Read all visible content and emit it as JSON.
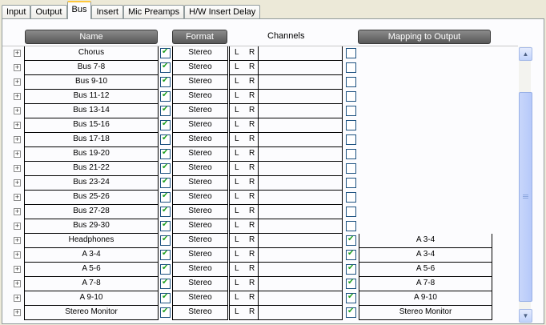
{
  "tabs": [
    "Input",
    "Output",
    "Bus",
    "Insert",
    "Mic Preamps",
    "H/W Insert Delay"
  ],
  "active_tab": "Bus",
  "headers": {
    "name": "Name",
    "format": "Format",
    "channels": "Channels",
    "mapping": "Mapping to Output"
  },
  "rows": [
    {
      "name": "Chorus",
      "format": "Stereo",
      "ch_l": "L",
      "ch_r": "R",
      "active": true,
      "mapped": false,
      "mapping": ""
    },
    {
      "name": "Bus 7-8",
      "format": "Stereo",
      "ch_l": "L",
      "ch_r": "R",
      "active": true,
      "mapped": false,
      "mapping": ""
    },
    {
      "name": "Bus 9-10",
      "format": "Stereo",
      "ch_l": "L",
      "ch_r": "R",
      "active": true,
      "mapped": false,
      "mapping": ""
    },
    {
      "name": "Bus 11-12",
      "format": "Stereo",
      "ch_l": "L",
      "ch_r": "R",
      "active": true,
      "mapped": false,
      "mapping": ""
    },
    {
      "name": "Bus 13-14",
      "format": "Stereo",
      "ch_l": "L",
      "ch_r": "R",
      "active": true,
      "mapped": false,
      "mapping": ""
    },
    {
      "name": "Bus 15-16",
      "format": "Stereo",
      "ch_l": "L",
      "ch_r": "R",
      "active": true,
      "mapped": false,
      "mapping": ""
    },
    {
      "name": "Bus 17-18",
      "format": "Stereo",
      "ch_l": "L",
      "ch_r": "R",
      "active": true,
      "mapped": false,
      "mapping": ""
    },
    {
      "name": "Bus 19-20",
      "format": "Stereo",
      "ch_l": "L",
      "ch_r": "R",
      "active": true,
      "mapped": false,
      "mapping": ""
    },
    {
      "name": "Bus 21-22",
      "format": "Stereo",
      "ch_l": "L",
      "ch_r": "R",
      "active": true,
      "mapped": false,
      "mapping": ""
    },
    {
      "name": "Bus 23-24",
      "format": "Stereo",
      "ch_l": "L",
      "ch_r": "R",
      "active": true,
      "mapped": false,
      "mapping": ""
    },
    {
      "name": "Bus 25-26",
      "format": "Stereo",
      "ch_l": "L",
      "ch_r": "R",
      "active": true,
      "mapped": false,
      "mapping": ""
    },
    {
      "name": "Bus 27-28",
      "format": "Stereo",
      "ch_l": "L",
      "ch_r": "R",
      "active": true,
      "mapped": false,
      "mapping": ""
    },
    {
      "name": "Bus 29-30",
      "format": "Stereo",
      "ch_l": "L",
      "ch_r": "R",
      "active": true,
      "mapped": false,
      "mapping": ""
    },
    {
      "name": "Headphones",
      "format": "Stereo",
      "ch_l": "L",
      "ch_r": "R",
      "active": true,
      "mapped": true,
      "mapping": "A 3-4"
    },
    {
      "name": "A 3-4",
      "format": "Stereo",
      "ch_l": "L",
      "ch_r": "R",
      "active": true,
      "mapped": true,
      "mapping": "A 3-4"
    },
    {
      "name": "A 5-6",
      "format": "Stereo",
      "ch_l": "L",
      "ch_r": "R",
      "active": true,
      "mapped": true,
      "mapping": "A 5-6"
    },
    {
      "name": "A 7-8",
      "format": "Stereo",
      "ch_l": "L",
      "ch_r": "R",
      "active": true,
      "mapped": true,
      "mapping": "A 7-8"
    },
    {
      "name": "A 9-10",
      "format": "Stereo",
      "ch_l": "L",
      "ch_r": "R",
      "active": true,
      "mapped": true,
      "mapping": "A 9-10"
    },
    {
      "name": "Stereo Monitor",
      "format": "Stereo",
      "ch_l": "L",
      "ch_r": "R",
      "active": true,
      "mapped": true,
      "mapping": "Stereo Monitor"
    }
  ],
  "icons": {
    "expander": "plus-box-icon",
    "scroll_up": "arrow-up-icon",
    "scroll_down": "arrow-down-icon"
  },
  "colors": {
    "header_button": "#6e6e6e",
    "check": "#21a121",
    "tab_highlight": "#ffc83c"
  },
  "scroll": {
    "position": 0.6
  }
}
